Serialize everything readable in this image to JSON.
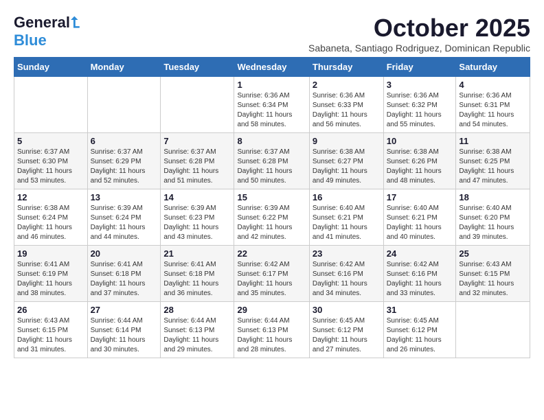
{
  "header": {
    "logo_general": "General",
    "logo_blue": "Blue",
    "month_title": "October 2025",
    "subtitle": "Sabaneta, Santiago Rodriguez, Dominican Republic"
  },
  "days_of_week": [
    "Sunday",
    "Monday",
    "Tuesday",
    "Wednesday",
    "Thursday",
    "Friday",
    "Saturday"
  ],
  "weeks": [
    {
      "days": [
        {
          "number": "",
          "info": ""
        },
        {
          "number": "",
          "info": ""
        },
        {
          "number": "",
          "info": ""
        },
        {
          "number": "1",
          "info": "Sunrise: 6:36 AM\nSunset: 6:34 PM\nDaylight: 11 hours\nand 58 minutes."
        },
        {
          "number": "2",
          "info": "Sunrise: 6:36 AM\nSunset: 6:33 PM\nDaylight: 11 hours\nand 56 minutes."
        },
        {
          "number": "3",
          "info": "Sunrise: 6:36 AM\nSunset: 6:32 PM\nDaylight: 11 hours\nand 55 minutes."
        },
        {
          "number": "4",
          "info": "Sunrise: 6:36 AM\nSunset: 6:31 PM\nDaylight: 11 hours\nand 54 minutes."
        }
      ]
    },
    {
      "days": [
        {
          "number": "5",
          "info": "Sunrise: 6:37 AM\nSunset: 6:30 PM\nDaylight: 11 hours\nand 53 minutes."
        },
        {
          "number": "6",
          "info": "Sunrise: 6:37 AM\nSunset: 6:29 PM\nDaylight: 11 hours\nand 52 minutes."
        },
        {
          "number": "7",
          "info": "Sunrise: 6:37 AM\nSunset: 6:28 PM\nDaylight: 11 hours\nand 51 minutes."
        },
        {
          "number": "8",
          "info": "Sunrise: 6:37 AM\nSunset: 6:28 PM\nDaylight: 11 hours\nand 50 minutes."
        },
        {
          "number": "9",
          "info": "Sunrise: 6:38 AM\nSunset: 6:27 PM\nDaylight: 11 hours\nand 49 minutes."
        },
        {
          "number": "10",
          "info": "Sunrise: 6:38 AM\nSunset: 6:26 PM\nDaylight: 11 hours\nand 48 minutes."
        },
        {
          "number": "11",
          "info": "Sunrise: 6:38 AM\nSunset: 6:25 PM\nDaylight: 11 hours\nand 47 minutes."
        }
      ]
    },
    {
      "days": [
        {
          "number": "12",
          "info": "Sunrise: 6:38 AM\nSunset: 6:24 PM\nDaylight: 11 hours\nand 46 minutes."
        },
        {
          "number": "13",
          "info": "Sunrise: 6:39 AM\nSunset: 6:24 PM\nDaylight: 11 hours\nand 44 minutes."
        },
        {
          "number": "14",
          "info": "Sunrise: 6:39 AM\nSunset: 6:23 PM\nDaylight: 11 hours\nand 43 minutes."
        },
        {
          "number": "15",
          "info": "Sunrise: 6:39 AM\nSunset: 6:22 PM\nDaylight: 11 hours\nand 42 minutes."
        },
        {
          "number": "16",
          "info": "Sunrise: 6:40 AM\nSunset: 6:21 PM\nDaylight: 11 hours\nand 41 minutes."
        },
        {
          "number": "17",
          "info": "Sunrise: 6:40 AM\nSunset: 6:21 PM\nDaylight: 11 hours\nand 40 minutes."
        },
        {
          "number": "18",
          "info": "Sunrise: 6:40 AM\nSunset: 6:20 PM\nDaylight: 11 hours\nand 39 minutes."
        }
      ]
    },
    {
      "days": [
        {
          "number": "19",
          "info": "Sunrise: 6:41 AM\nSunset: 6:19 PM\nDaylight: 11 hours\nand 38 minutes."
        },
        {
          "number": "20",
          "info": "Sunrise: 6:41 AM\nSunset: 6:18 PM\nDaylight: 11 hours\nand 37 minutes."
        },
        {
          "number": "21",
          "info": "Sunrise: 6:41 AM\nSunset: 6:18 PM\nDaylight: 11 hours\nand 36 minutes."
        },
        {
          "number": "22",
          "info": "Sunrise: 6:42 AM\nSunset: 6:17 PM\nDaylight: 11 hours\nand 35 minutes."
        },
        {
          "number": "23",
          "info": "Sunrise: 6:42 AM\nSunset: 6:16 PM\nDaylight: 11 hours\nand 34 minutes."
        },
        {
          "number": "24",
          "info": "Sunrise: 6:42 AM\nSunset: 6:16 PM\nDaylight: 11 hours\nand 33 minutes."
        },
        {
          "number": "25",
          "info": "Sunrise: 6:43 AM\nSunset: 6:15 PM\nDaylight: 11 hours\nand 32 minutes."
        }
      ]
    },
    {
      "days": [
        {
          "number": "26",
          "info": "Sunrise: 6:43 AM\nSunset: 6:15 PM\nDaylight: 11 hours\nand 31 minutes."
        },
        {
          "number": "27",
          "info": "Sunrise: 6:44 AM\nSunset: 6:14 PM\nDaylight: 11 hours\nand 30 minutes."
        },
        {
          "number": "28",
          "info": "Sunrise: 6:44 AM\nSunset: 6:13 PM\nDaylight: 11 hours\nand 29 minutes."
        },
        {
          "number": "29",
          "info": "Sunrise: 6:44 AM\nSunset: 6:13 PM\nDaylight: 11 hours\nand 28 minutes."
        },
        {
          "number": "30",
          "info": "Sunrise: 6:45 AM\nSunset: 6:12 PM\nDaylight: 11 hours\nand 27 minutes."
        },
        {
          "number": "31",
          "info": "Sunrise: 6:45 AM\nSunset: 6:12 PM\nDaylight: 11 hours\nand 26 minutes."
        },
        {
          "number": "",
          "info": ""
        }
      ]
    }
  ]
}
